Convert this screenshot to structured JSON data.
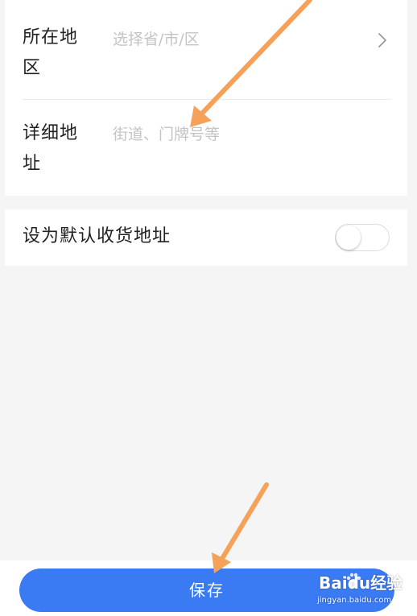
{
  "address_form": {
    "region": {
      "label": "所在地区",
      "placeholder": "选择省/市/区"
    },
    "detail": {
      "label": "详细地址",
      "placeholder": "街道、门牌号等"
    }
  },
  "default_setting": {
    "label": "设为默认收货地址",
    "enabled": false
  },
  "footer": {
    "save_label": "保存"
  },
  "watermark": {
    "brand": "Baidu经验",
    "url": "jingyan.baidu.com"
  },
  "colors": {
    "primary": "#3a7af2",
    "annotation_arrow": "#f5a15a",
    "page_background": "#f5f5f5"
  },
  "icons": {
    "region_chevron": "chevron-right-icon",
    "watermark_paw": "baidu-paw-icon"
  }
}
